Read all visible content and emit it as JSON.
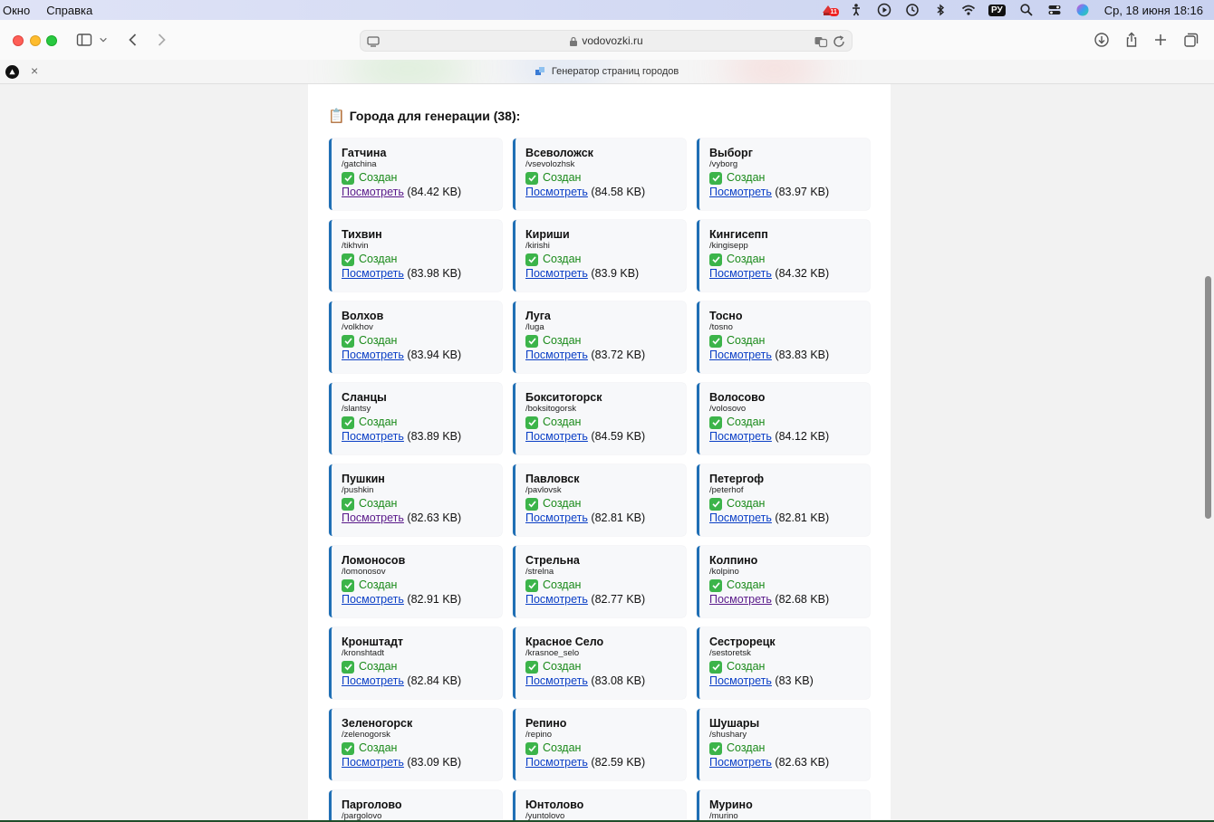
{
  "menubar": {
    "items": [
      "Окно",
      "Справка"
    ],
    "badge_count": "11",
    "input_source": "РУ",
    "clock": "Ср, 18 июня 18:16"
  },
  "browser": {
    "url": "vodovozki.ru",
    "tab_title": "Генератор страниц городов",
    "tab_close": "×"
  },
  "page": {
    "heading_icon": "📋",
    "heading": "Города для генерации (38):",
    "check_icon": "check-box-icon",
    "link_color": "#0b3fc6",
    "status_color": "#1a8a1a",
    "card_border_color": "#1f6fb5",
    "cities": [
      {
        "name": "Гатчина",
        "slug": "/gatchina",
        "status": "Создан",
        "link": "Посмотреть",
        "size": "(84.42 KB)",
        "visited": true
      },
      {
        "name": "Всеволожск",
        "slug": "/vsevolozhsk",
        "status": "Создан",
        "link": "Посмотреть",
        "size": "(84.58 KB)",
        "visited": false
      },
      {
        "name": "Выборг",
        "slug": "/vyborg",
        "status": "Создан",
        "link": "Посмотреть",
        "size": "(83.97 KB)",
        "visited": false
      },
      {
        "name": "Тихвин",
        "slug": "/tikhvin",
        "status": "Создан",
        "link": "Посмотреть",
        "size": "(83.98 KB)",
        "visited": false
      },
      {
        "name": "Кириши",
        "slug": "/kirishi",
        "status": "Создан",
        "link": "Посмотреть",
        "size": "(83.9 KB)",
        "visited": false
      },
      {
        "name": "Кингисепп",
        "slug": "/kingisepp",
        "status": "Создан",
        "link": "Посмотреть",
        "size": "(84.32 KB)",
        "visited": false
      },
      {
        "name": "Волхов",
        "slug": "/volkhov",
        "status": "Создан",
        "link": "Посмотреть",
        "size": "(83.94 KB)",
        "visited": false
      },
      {
        "name": "Луга",
        "slug": "/luga",
        "status": "Создан",
        "link": "Посмотреть",
        "size": "(83.72 KB)",
        "visited": false
      },
      {
        "name": "Тосно",
        "slug": "/tosno",
        "status": "Создан",
        "link": "Посмотреть",
        "size": "(83.83 KB)",
        "visited": false
      },
      {
        "name": "Сланцы",
        "slug": "/slantsy",
        "status": "Создан",
        "link": "Посмотреть",
        "size": "(83.89 KB)",
        "visited": false
      },
      {
        "name": "Бокситогорск",
        "slug": "/boksitogorsk",
        "status": "Создан",
        "link": "Посмотреть",
        "size": "(84.59 KB)",
        "visited": false
      },
      {
        "name": "Волосово",
        "slug": "/volosovo",
        "status": "Создан",
        "link": "Посмотреть",
        "size": "(84.12 KB)",
        "visited": false
      },
      {
        "name": "Пушкин",
        "slug": "/pushkin",
        "status": "Создан",
        "link": "Посмотреть",
        "size": "(82.63 KB)",
        "visited": true
      },
      {
        "name": "Павловск",
        "slug": "/pavlovsk",
        "status": "Создан",
        "link": "Посмотреть",
        "size": "(82.81 KB)",
        "visited": false
      },
      {
        "name": "Петергоф",
        "slug": "/peterhof",
        "status": "Создан",
        "link": "Посмотреть",
        "size": "(82.81 KB)",
        "visited": false
      },
      {
        "name": "Ломоносов",
        "slug": "/lomonosov",
        "status": "Создан",
        "link": "Посмотреть",
        "size": "(82.91 KB)",
        "visited": false
      },
      {
        "name": "Стрельна",
        "slug": "/strelna",
        "status": "Создан",
        "link": "Посмотреть",
        "size": "(82.77 KB)",
        "visited": false
      },
      {
        "name": "Колпино",
        "slug": "/kolpino",
        "status": "Создан",
        "link": "Посмотреть",
        "size": "(82.68 KB)",
        "visited": true
      },
      {
        "name": "Кронштадт",
        "slug": "/kronshtadt",
        "status": "Создан",
        "link": "Посмотреть",
        "size": "(82.84 KB)",
        "visited": false
      },
      {
        "name": "Красное Село",
        "slug": "/krasnoe_selo",
        "status": "Создан",
        "link": "Посмотреть",
        "size": "(83.08 KB)",
        "visited": false
      },
      {
        "name": "Сестрорецк",
        "slug": "/sestoretsk",
        "status": "Создан",
        "link": "Посмотреть",
        "size": "(83 KB)",
        "visited": false
      },
      {
        "name": "Зеленогорск",
        "slug": "/zelenogorsk",
        "status": "Создан",
        "link": "Посмотреть",
        "size": "(83.09 KB)",
        "visited": false
      },
      {
        "name": "Репино",
        "slug": "/repino",
        "status": "Создан",
        "link": "Посмотреть",
        "size": "(82.59 KB)",
        "visited": false
      },
      {
        "name": "Шушары",
        "slug": "/shushary",
        "status": "Создан",
        "link": "Посмотреть",
        "size": "(82.63 KB)",
        "visited": false
      },
      {
        "name": "Парголово",
        "slug": "/pargolovo",
        "status": "",
        "link": "",
        "size": "",
        "visited": false
      },
      {
        "name": "Юнтолово",
        "slug": "/yuntolovo",
        "status": "",
        "link": "",
        "size": "",
        "visited": false
      },
      {
        "name": "Мурино",
        "slug": "/murino",
        "status": "",
        "link": "",
        "size": "",
        "visited": false
      }
    ]
  }
}
